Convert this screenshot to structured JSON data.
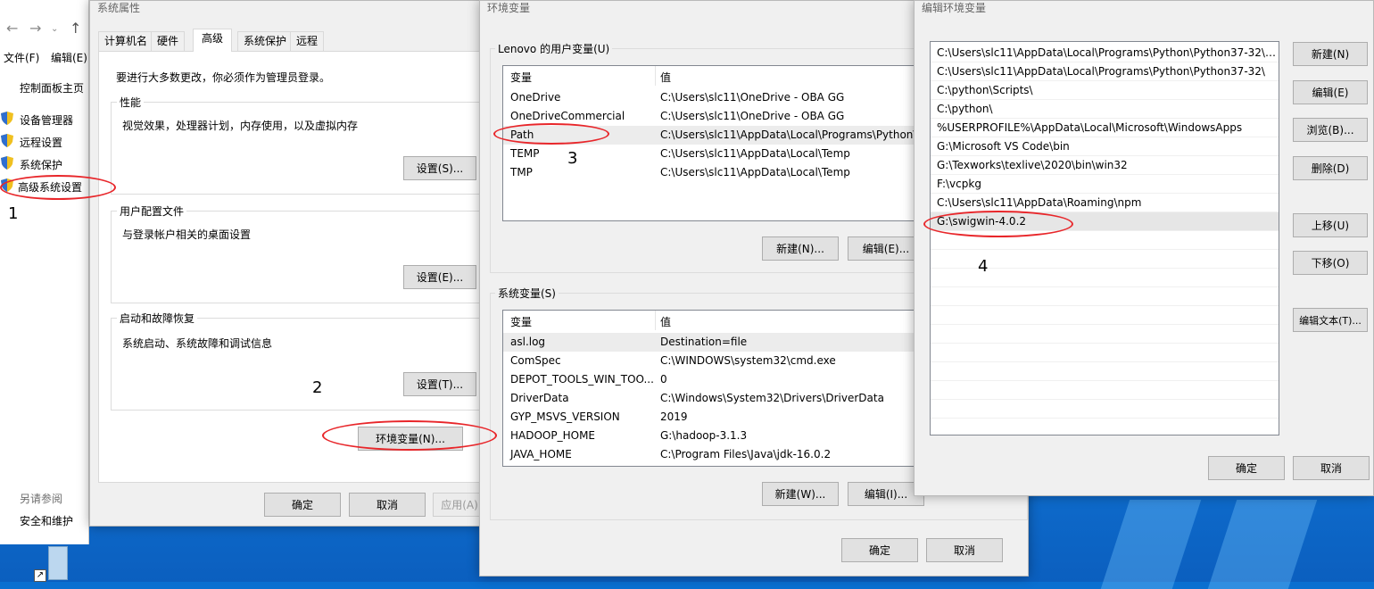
{
  "control_panel": {
    "menu_file": "文件(F)",
    "menu_edit": "编辑(E)",
    "home_link": "控制面板主页",
    "links": [
      "设备管理器",
      "远程设置",
      "系统保护",
      "高级系统设置"
    ],
    "see_also": "另请参阅",
    "security": "安全和维护"
  },
  "system_properties": {
    "title": "系统属性",
    "tabs": [
      "计算机名",
      "硬件",
      "高级",
      "系统保护",
      "远程"
    ],
    "admin_note": "要进行大多数更改，你必须作为管理员登录。",
    "performance": {
      "label": "性能",
      "desc": "视觉效果，处理器计划，内存使用，以及虚拟内存",
      "button": "设置(S)..."
    },
    "user_profiles": {
      "label": "用户配置文件",
      "desc": "与登录帐户相关的桌面设置",
      "button": "设置(E)..."
    },
    "startup": {
      "label": "启动和故障恢复",
      "desc": "系统启动、系统故障和调试信息",
      "button": "设置(T)..."
    },
    "env_button": "环境变量(N)...",
    "ok": "确定",
    "cancel": "取消",
    "apply": "应用(A)"
  },
  "env_vars": {
    "title": "环境变量",
    "user_group": "Lenovo 的用户变量(U)",
    "col_var": "变量",
    "col_val": "值",
    "user_vars": [
      {
        "name": "OneDrive",
        "value": "C:\\Users\\slc11\\OneDrive - OBA GG"
      },
      {
        "name": "OneDriveCommercial",
        "value": "C:\\Users\\slc11\\OneDrive - OBA GG"
      },
      {
        "name": "Path",
        "value": "C:\\Users\\slc11\\AppData\\Local\\Programs\\Python\\"
      },
      {
        "name": "TEMP",
        "value": "C:\\Users\\slc11\\AppData\\Local\\Temp"
      },
      {
        "name": "TMP",
        "value": "C:\\Users\\slc11\\AppData\\Local\\Temp"
      }
    ],
    "user_new": "新建(N)...",
    "user_edit": "编辑(E)...",
    "system_group": "系统变量(S)",
    "system_vars": [
      {
        "name": "asl.log",
        "value": "Destination=file"
      },
      {
        "name": "ComSpec",
        "value": "C:\\WINDOWS\\system32\\cmd.exe"
      },
      {
        "name": "DEPOT_TOOLS_WIN_TOO...",
        "value": "0"
      },
      {
        "name": "DriverData",
        "value": "C:\\Windows\\System32\\Drivers\\DriverData"
      },
      {
        "name": "GYP_MSVS_VERSION",
        "value": "2019"
      },
      {
        "name": "HADOOP_HOME",
        "value": "G:\\hadoop-3.1.3"
      },
      {
        "name": "JAVA_HOME",
        "value": "C:\\Program Files\\Java\\jdk-16.0.2"
      }
    ],
    "sys_new": "新建(W)...",
    "sys_edit": "编辑(I)...",
    "ok": "确定",
    "cancel": "取消"
  },
  "edit_env": {
    "title": "编辑环境变量",
    "paths": [
      "C:\\Users\\slc11\\AppData\\Local\\Programs\\Python\\Python37-32\\S...",
      "C:\\Users\\slc11\\AppData\\Local\\Programs\\Python\\Python37-32\\",
      "C:\\python\\Scripts\\",
      "C:\\python\\",
      "%USERPROFILE%\\AppData\\Local\\Microsoft\\WindowsApps",
      "G:\\Microsoft VS Code\\bin",
      "G:\\Texworks\\texlive\\2020\\bin\\win32",
      "F:\\vcpkg",
      "C:\\Users\\slc11\\AppData\\Roaming\\npm",
      "G:\\swigwin-4.0.2"
    ],
    "buttons": {
      "new": "新建(N)",
      "edit": "编辑(E)",
      "browse": "浏览(B)...",
      "delete": "删除(D)",
      "up": "上移(U)",
      "down": "下移(O)",
      "edit_text": "编辑文本(T)..."
    },
    "ok": "确定",
    "cancel": "取消"
  },
  "annotations": [
    "1",
    "2",
    "3",
    "4"
  ],
  "colors": {
    "annotation_ring": "#e8262a",
    "desktop": "#1587e8",
    "dialog_bg": "#f0f0f0"
  }
}
